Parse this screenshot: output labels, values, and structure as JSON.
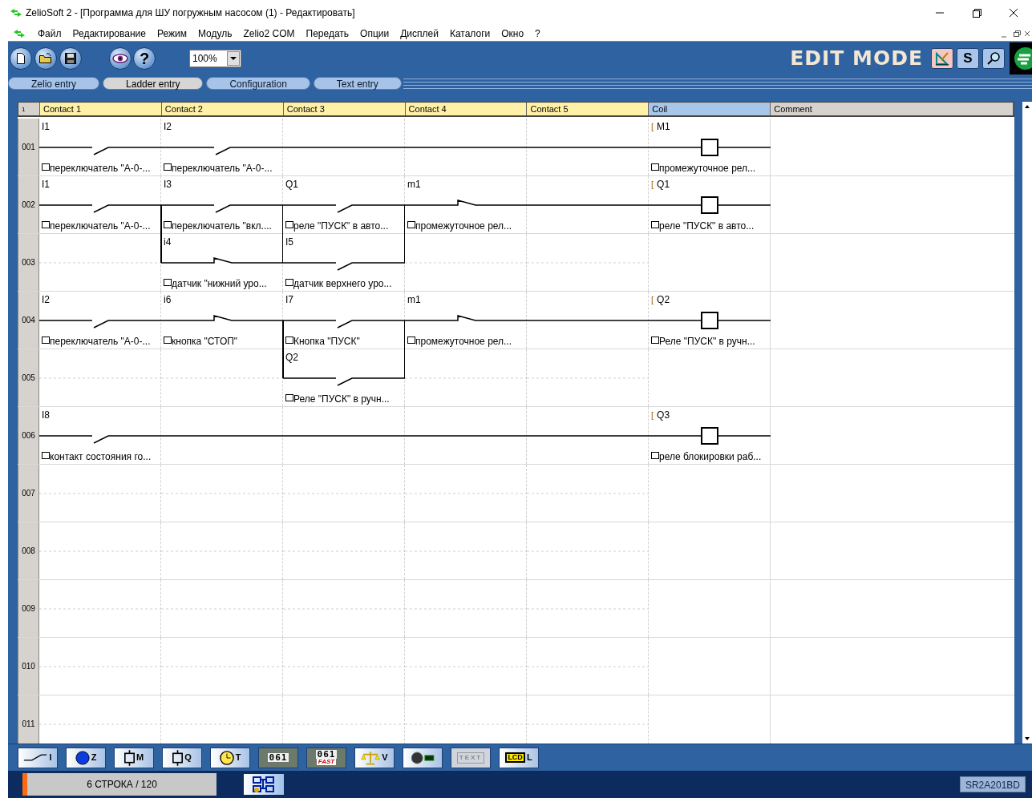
{
  "window": {
    "title": "ZelioSoft 2 - [Программа для ШУ погружным насосом (1) - Редактировать]"
  },
  "menu": [
    "Файл",
    "Редактирование",
    "Режим",
    "Модуль",
    "Zelio2 COM",
    "Передать",
    "Опции",
    "Дисплей",
    "Каталоги",
    "Окно",
    "?"
  ],
  "toolbar": {
    "help": "?",
    "zoom": "100%",
    "mode": "EDIT MODE",
    "mode_buttons": [
      {
        "kind": "draw",
        "selected": true
      },
      {
        "kind": "text",
        "label": "S",
        "selected": false
      },
      {
        "kind": "search",
        "selected": false
      }
    ]
  },
  "tabs": [
    {
      "label": "Zelio entry",
      "selected": false
    },
    {
      "label": "Ladder entry",
      "selected": true
    },
    {
      "label": "Configuration",
      "selected": false
    },
    {
      "label": "Text entry",
      "selected": false
    }
  ],
  "grid": {
    "corner": "1",
    "columns": [
      {
        "label": "Contact 1",
        "kind": "contact"
      },
      {
        "label": "Contact 2",
        "kind": "contact"
      },
      {
        "label": "Contact 3",
        "kind": "contact"
      },
      {
        "label": "Contact 4",
        "kind": "contact"
      },
      {
        "label": "Contact 5",
        "kind": "contact"
      },
      {
        "label": "Coil",
        "kind": "coil"
      },
      {
        "label": "Comment",
        "kind": "comment"
      }
    ],
    "rows": [
      {
        "number": "001",
        "cells": [
          {
            "kind": "no",
            "label": "I1",
            "comment": "переключатель \"А-0-..."
          },
          {
            "kind": "no",
            "label": "I2",
            "comment": "переключатель \"А-0-..."
          },
          {
            "kind": "wire"
          },
          {
            "kind": "wire"
          },
          {
            "kind": "wire"
          },
          {
            "kind": "coil",
            "prefix": "[",
            "label": "M1",
            "comment": "промежуточное рел..."
          }
        ]
      },
      {
        "number": "002",
        "cells": [
          {
            "kind": "no",
            "label": "I1",
            "comment": "переключатель \"А-0-..."
          },
          {
            "kind": "no",
            "label": "I3",
            "comment": "переключатель \"вкл...."
          },
          {
            "kind": "no",
            "label": "Q1",
            "comment": "реле \"ПУСК\" в авто..."
          },
          {
            "kind": "nc",
            "label": "m1",
            "comment": "промежуточное рел..."
          },
          {
            "kind": "wire"
          },
          {
            "kind": "coil",
            "prefix": "[",
            "label": "Q1",
            "comment": "реле \"ПУСК\" в авто..."
          }
        ]
      },
      {
        "number": "003",
        "cells": [
          {
            "kind": "empty"
          },
          {
            "kind": "nc",
            "label": "i4",
            "comment": "датчик \"нижний уро...",
            "branch_left": true,
            "branch_right": true
          },
          {
            "kind": "no",
            "label": "I5",
            "comment": "датчик верхнего уро...",
            "branch_right": true
          },
          {
            "kind": "empty"
          },
          {
            "kind": "empty"
          },
          {
            "kind": "empty"
          }
        ]
      },
      {
        "number": "004",
        "cells": [
          {
            "kind": "no",
            "label": "I2",
            "comment": "переключатель \"А-0-..."
          },
          {
            "kind": "nc",
            "label": "i6",
            "comment": "кнопка \"СТОП\""
          },
          {
            "kind": "no",
            "label": "I7",
            "comment": "Кнопка \"ПУСК\""
          },
          {
            "kind": "nc",
            "label": "m1",
            "comment": "промежуточное рел..."
          },
          {
            "kind": "wire"
          },
          {
            "kind": "coil",
            "prefix": "[",
            "label": "Q2",
            "comment": "Реле \"ПУСК\" в ручн..."
          }
        ]
      },
      {
        "number": "005",
        "cells": [
          {
            "kind": "empty"
          },
          {
            "kind": "empty"
          },
          {
            "kind": "no",
            "label": "Q2",
            "comment": "Реле \"ПУСК\" в ручн...",
            "branch_left": true,
            "branch_right": true
          },
          {
            "kind": "empty"
          },
          {
            "kind": "empty"
          },
          {
            "kind": "empty"
          }
        ]
      },
      {
        "number": "006",
        "cells": [
          {
            "kind": "no",
            "label": "I8",
            "comment": "контакт состояния го..."
          },
          {
            "kind": "wire"
          },
          {
            "kind": "wire"
          },
          {
            "kind": "wire"
          },
          {
            "kind": "wire"
          },
          {
            "kind": "coil",
            "prefix": "[",
            "label": "Q3",
            "comment": "реле блокировки раб..."
          }
        ]
      },
      {
        "number": "007"
      },
      {
        "number": "008"
      },
      {
        "number": "009"
      },
      {
        "number": "010"
      },
      {
        "number": "011"
      }
    ]
  },
  "palette": [
    {
      "kind": "input",
      "letter": "I"
    },
    {
      "kind": "key",
      "letter": "Z"
    },
    {
      "kind": "relay",
      "letter": "M"
    },
    {
      "kind": "output",
      "letter": "Q"
    },
    {
      "kind": "timer",
      "letter": "T"
    },
    {
      "kind": "counter",
      "text": "061"
    },
    {
      "kind": "fast_counter",
      "text": "061",
      "caption": "FAST"
    },
    {
      "kind": "compare",
      "letter": "V"
    },
    {
      "kind": "analog"
    },
    {
      "kind": "text_block",
      "text": "TEXT"
    },
    {
      "kind": "lcd",
      "text": "LCD",
      "letter": "L"
    }
  ],
  "status_bar": {
    "row_info": "6 СТРОКА / 120",
    "device": "SR2A201BD"
  }
}
